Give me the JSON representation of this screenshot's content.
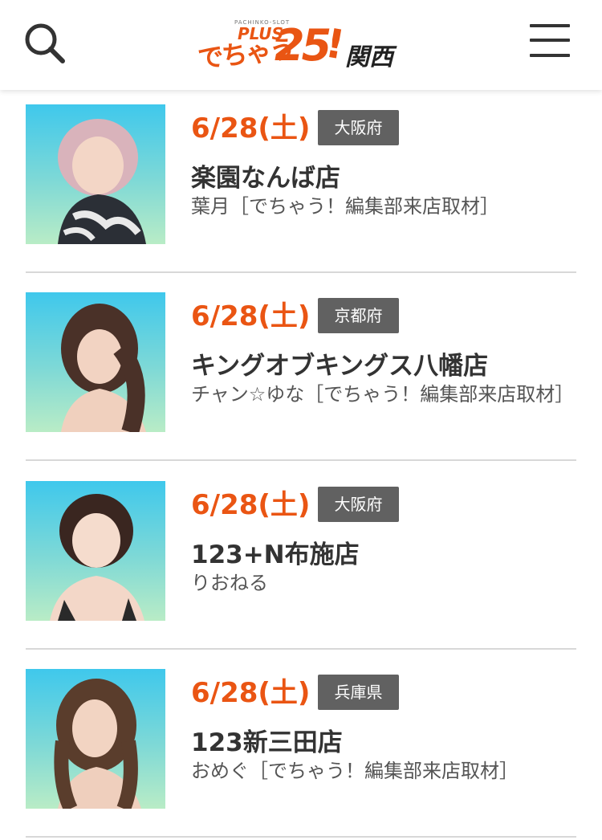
{
  "header": {
    "logo": {
      "small_text": "PACHINKO-SLOT",
      "plus": "PLUS",
      "main": "でちゃう",
      "number": "25",
      "exclaim": "!",
      "region": "関西"
    }
  },
  "items": [
    {
      "date": "6/28(土)",
      "prefecture": "大阪府",
      "store": "楽園なんば店",
      "description": "葉月［でちゃう！編集部来店取材］"
    },
    {
      "date": "6/28(土)",
      "prefecture": "京都府",
      "store": "キングオブキングス八幡店",
      "description": "チャン☆ゆな［でちゃう！編集部来店取材］"
    },
    {
      "date": "6/28(土)",
      "prefecture": "大阪府",
      "store": "123+N布施店",
      "description": "りおねる"
    },
    {
      "date": "6/28(土)",
      "prefecture": "兵庫県",
      "store": "123新三田店",
      "description": "おめぐ［でちゃう！編集部来店取材］"
    }
  ],
  "colors": {
    "accent": "#ea5513",
    "badge": "#616161",
    "thumb_top": "#3fc8ec",
    "thumb_bottom": "#b9ecc6"
  }
}
